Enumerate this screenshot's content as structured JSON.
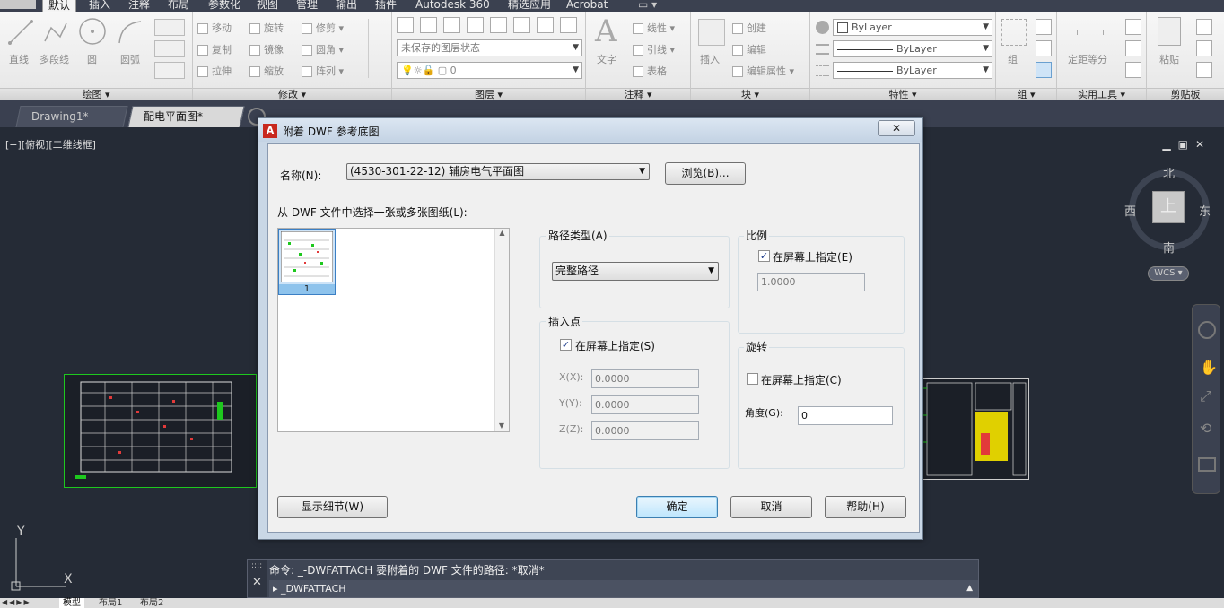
{
  "menubar": {
    "tabs": [
      "默认",
      "插入",
      "注释",
      "布局",
      "参数化",
      "视图",
      "管理",
      "输出",
      "插件",
      "Autodesk 360",
      "精选应用",
      "Acrobat"
    ],
    "active": "默认"
  },
  "ribbon": {
    "draw": {
      "title": "绘图 ▾",
      "line": "直线",
      "polyline": "多段线",
      "circle": "圆",
      "arc": "圆弧"
    },
    "modify": {
      "title": "修改 ▾",
      "move": "移动",
      "rotate": "旋转",
      "trim": "修剪",
      "copy": "复制",
      "mirror": "镜像",
      "fillet": "圆角",
      "stretch": "拉伸",
      "scale": "缩放",
      "array": "阵列"
    },
    "layers": {
      "title": "图层 ▾",
      "state": "未保存的图层状态",
      "current_layer": "0"
    },
    "annotation": {
      "title": "注释 ▾",
      "text": "文字",
      "linear": "线性",
      "leader": "引线",
      "table": "表格"
    },
    "block": {
      "title": "块 ▾",
      "insert": "插入",
      "create": "创建",
      "edit": "编辑",
      "edit_attr": "编辑属性"
    },
    "properties": {
      "title": "特性 ▾",
      "color": "ByLayer",
      "linetype": "ByLayer",
      "lineweight": "ByLayer"
    },
    "group": {
      "title": "组 ▾",
      "group": "组"
    },
    "utilities": {
      "title": "实用工具 ▾",
      "measure": "定距等分"
    },
    "clipboard": {
      "title": "剪贴板",
      "paste": "粘贴"
    }
  },
  "doctabs": {
    "tab1": "Drawing1*",
    "tab2": "配电平面图*"
  },
  "viewport": {
    "label": "[−][俯视][二维线框]"
  },
  "viewcube": {
    "north": "北",
    "south": "南",
    "east": "东",
    "west": "西",
    "top": "上",
    "wcs": "WCS"
  },
  "dialog": {
    "title": "附着 DWF 参考底图",
    "name_label": "名称(N):",
    "name_value": "(4530-301-22-12)  辅房电气平面图",
    "browse_button": "浏览(B)...",
    "sheet_select_label": "从 DWF 文件中选择一张或多张图纸(L):",
    "sheet_number": "1",
    "path_type_label": "路径类型(A)",
    "path_type_value": "完整路径",
    "scale_label": "比例",
    "scale_onscreen": "在屏幕上指定(E)",
    "scale_value": "1.0000",
    "insert_label": "插入点",
    "insert_onscreen": "在屏幕上指定(S)",
    "x_label": "X(X):",
    "x_value": "0.0000",
    "y_label": "Y(Y):",
    "y_value": "0.0000",
    "z_label": "Z(Z):",
    "z_value": "0.0000",
    "rotation_label": "旋转",
    "rotation_onscreen": "在屏幕上指定(C)",
    "angle_label": "角度(G):",
    "angle_value": "0",
    "details_button": "显示细节(W)",
    "ok_button": "确定",
    "cancel_button": "取消",
    "help_button": "帮助(H)"
  },
  "command": {
    "history": "命令: _-DWFATTACH 要附着的 DWF 文件的路径: *取消*",
    "prompt": "▸ _DWFATTACH"
  },
  "layout_tabs": [
    "模型",
    "布局1",
    "布局2"
  ],
  "ucs": {
    "x": "X",
    "y": "Y"
  },
  "colors": {
    "accent_green": "#1ec81e",
    "canvas": "#252b36",
    "dialog_frame": "#c9d7e6"
  }
}
